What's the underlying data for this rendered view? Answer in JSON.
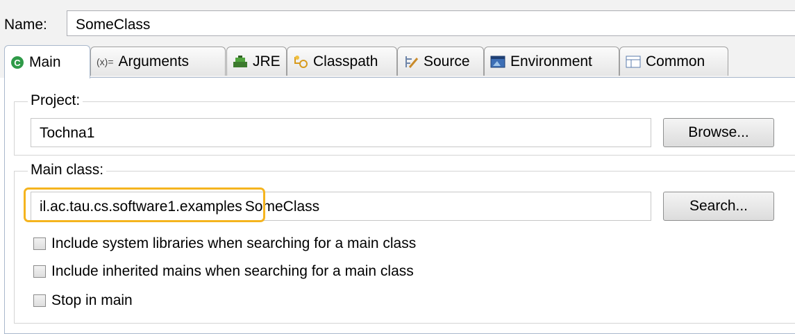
{
  "name": {
    "label": "Name:",
    "value": "SomeClass"
  },
  "tabs": [
    {
      "label": "Main",
      "icon": "main-class-icon",
      "active": true
    },
    {
      "label": "Arguments",
      "icon": "arguments-icon",
      "active": false
    },
    {
      "label": "JRE",
      "icon": "jre-icon",
      "active": false
    },
    {
      "label": "Classpath",
      "icon": "classpath-icon",
      "active": false
    },
    {
      "label": "Source",
      "icon": "source-icon",
      "active": false
    },
    {
      "label": "Environment",
      "icon": "environment-icon",
      "active": false
    },
    {
      "label": "Common",
      "icon": "common-icon",
      "active": false
    }
  ],
  "arguments_icon_text": "(x)=",
  "project": {
    "title": "Project:",
    "value": "Tochna1",
    "button": "Browse..."
  },
  "main_class": {
    "title": "Main class:",
    "package": "il.ac.tau.cs.software1.examples",
    "class": "SomeClass",
    "button": "Search..."
  },
  "options": [
    {
      "label": "Include system libraries when searching for a main class",
      "checked": false
    },
    {
      "label": "Include inherited mains when searching for a main class",
      "checked": false
    },
    {
      "label": "Stop in main",
      "checked": false
    }
  ],
  "colors": {
    "highlight": "#f5b41e",
    "main_icon": "#2f9a48",
    "panel_border": "#a9b8cc"
  }
}
